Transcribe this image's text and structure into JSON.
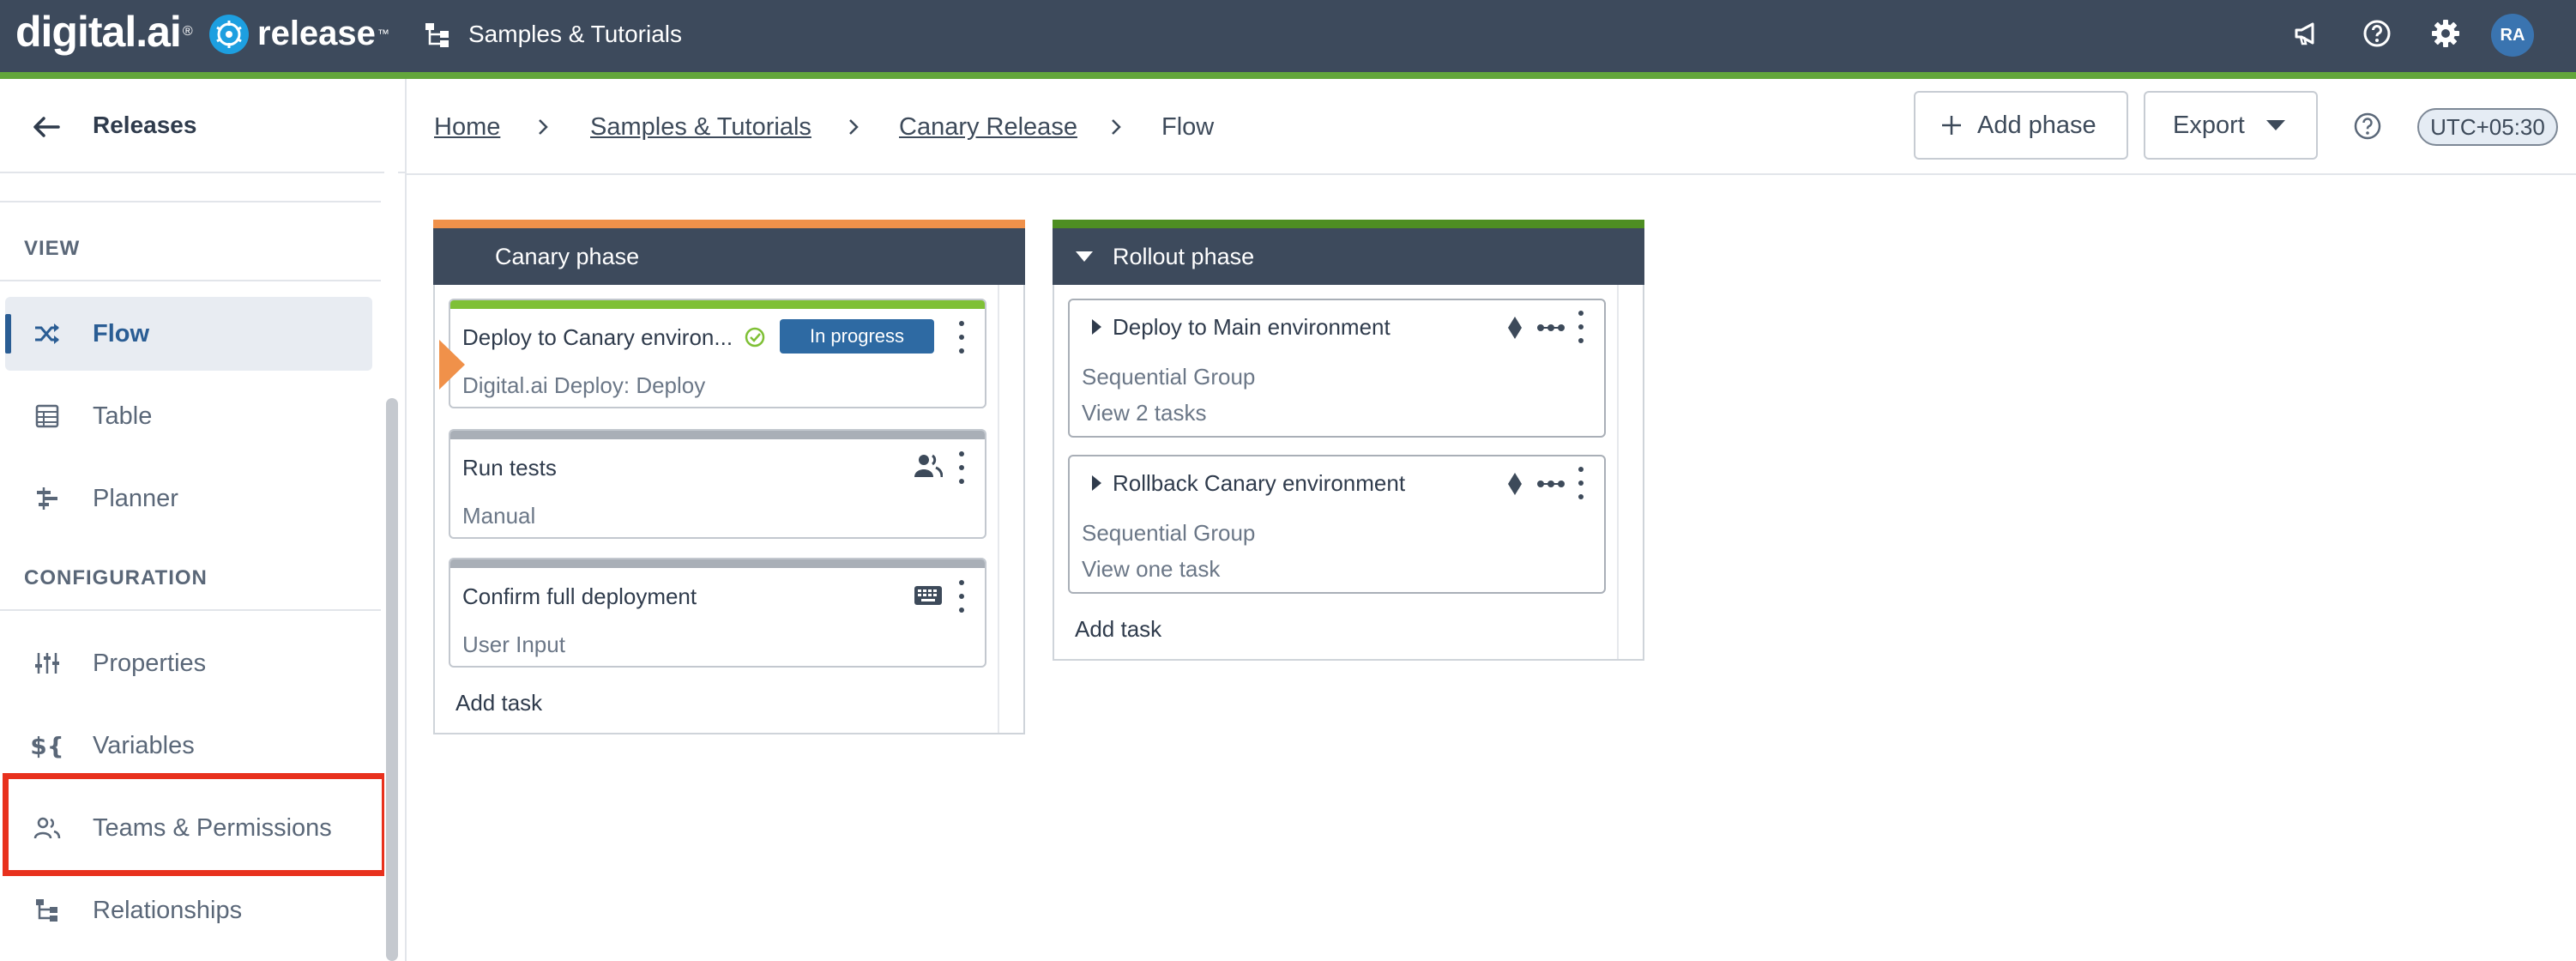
{
  "topbar": {
    "brand": "digital.ai",
    "product": "release",
    "folder_title": "Samples & Tutorials",
    "avatar_initials": "RA",
    "colors": {
      "bar": "#3d4a5c",
      "accent": "#63a63b"
    }
  },
  "sidebar": {
    "back_title": "Releases",
    "sections": {
      "view": "VIEW",
      "configuration": "CONFIGURATION"
    },
    "items": [
      {
        "label": "Flow",
        "icon": "shuffle-icon",
        "active": true
      },
      {
        "label": "Table",
        "icon": "table-icon",
        "active": false
      },
      {
        "label": "Planner",
        "icon": "planner-icon",
        "active": false
      },
      {
        "label": "Properties",
        "icon": "sliders-icon",
        "active": false
      },
      {
        "label": "Variables",
        "icon": "variables-icon",
        "active": false
      },
      {
        "label": "Teams & Permissions",
        "icon": "users-icon",
        "active": false
      },
      {
        "label": "Relationships",
        "icon": "hierarchy-icon",
        "active": false
      }
    ]
  },
  "breadcrumb": {
    "items": [
      {
        "label": "Home",
        "link": true
      },
      {
        "label": "Samples & Tutorials",
        "link": true
      },
      {
        "label": "Canary Release",
        "link": true
      },
      {
        "label": "Flow",
        "link": false
      }
    ]
  },
  "toolbar": {
    "add_phase": "Add phase",
    "export": "Export",
    "timezone": "UTC+05:30"
  },
  "phases": [
    {
      "title": "Canary phase",
      "bar_color": "#f0914a",
      "tasks": [
        {
          "title": "Deploy to Canary environ...",
          "subtitle": "Digital.ai Deploy: Deploy",
          "status": "In progress",
          "top_color": "#7fc036"
        },
        {
          "title": "Run tests",
          "subtitle": "Manual",
          "top_color": "#a9afb7"
        },
        {
          "title": "Confirm full deployment",
          "subtitle": "User Input",
          "top_color": "#a9afb7"
        }
      ],
      "add_task": "Add task"
    },
    {
      "title": "Rollout phase",
      "bar_color": "#4e8e22",
      "tasks": [
        {
          "title": "Deploy to Main environment",
          "subtitle": "Sequential Group",
          "link": "View 2 tasks"
        },
        {
          "title": "Rollback Canary environment",
          "subtitle": "Sequential Group",
          "link": "View one task"
        }
      ],
      "add_task": "Add task"
    }
  ]
}
